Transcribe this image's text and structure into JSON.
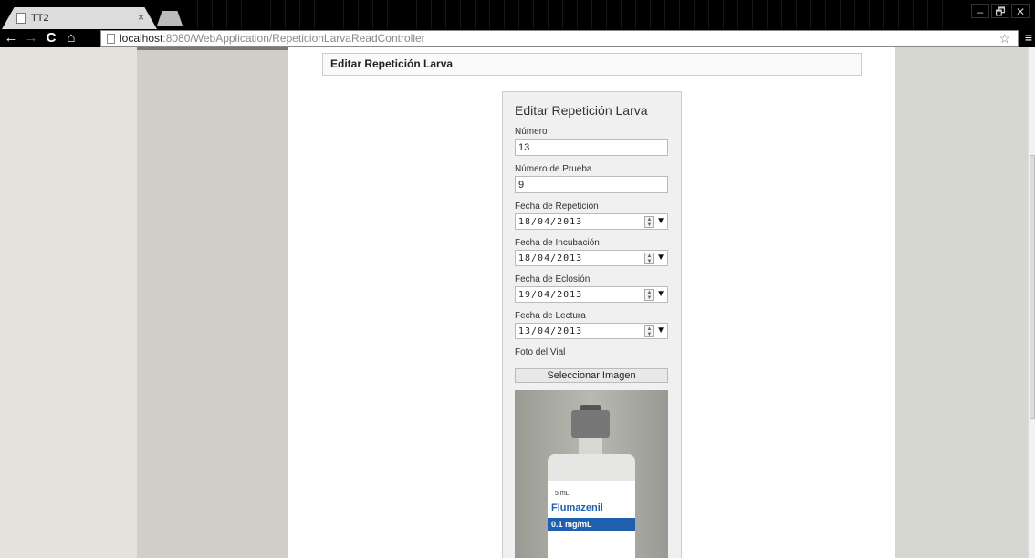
{
  "browser": {
    "tab_title": "TT2",
    "tab_close": "×",
    "url_host": "localhost",
    "url_path": ":8080/WebApplication/RepeticionLarvaReadController",
    "back_icon": "←",
    "forward_icon": "→",
    "reload_icon": "C",
    "home_icon": "⌂",
    "star_icon": "☆",
    "menu_icon": "≡",
    "minimize": "–",
    "restore": "🗗",
    "close": "✕"
  },
  "page": {
    "header_title": "Editar Repetición Larva"
  },
  "form": {
    "title": "Editar Repetición Larva",
    "numero_label": "Número",
    "numero_value": "13",
    "numero_prueba_label": "Número de Prueba",
    "numero_prueba_value": "9",
    "fecha_repeticion_label": "Fecha de Repetición",
    "fecha_repeticion_value": "18/04/2013",
    "fecha_incubacion_label": "Fecha de Incubación",
    "fecha_incubacion_value": "18/04/2013",
    "fecha_eclosion_label": "Fecha de Eclosión",
    "fecha_eclosion_value": "19/04/2013",
    "fecha_lectura_label": "Fecha de Lectura",
    "fecha_lectura_value": "13/04/2013",
    "foto_label": "Foto del Vial",
    "select_image_label": "Seleccionar Imagen",
    "dropdown_icon": "▼",
    "spin_up": "▲",
    "spin_down": "▼"
  },
  "vial": {
    "volume": "5 mL",
    "drug_name": "Flumazenil",
    "concentration": "0.1 mg/mL"
  }
}
